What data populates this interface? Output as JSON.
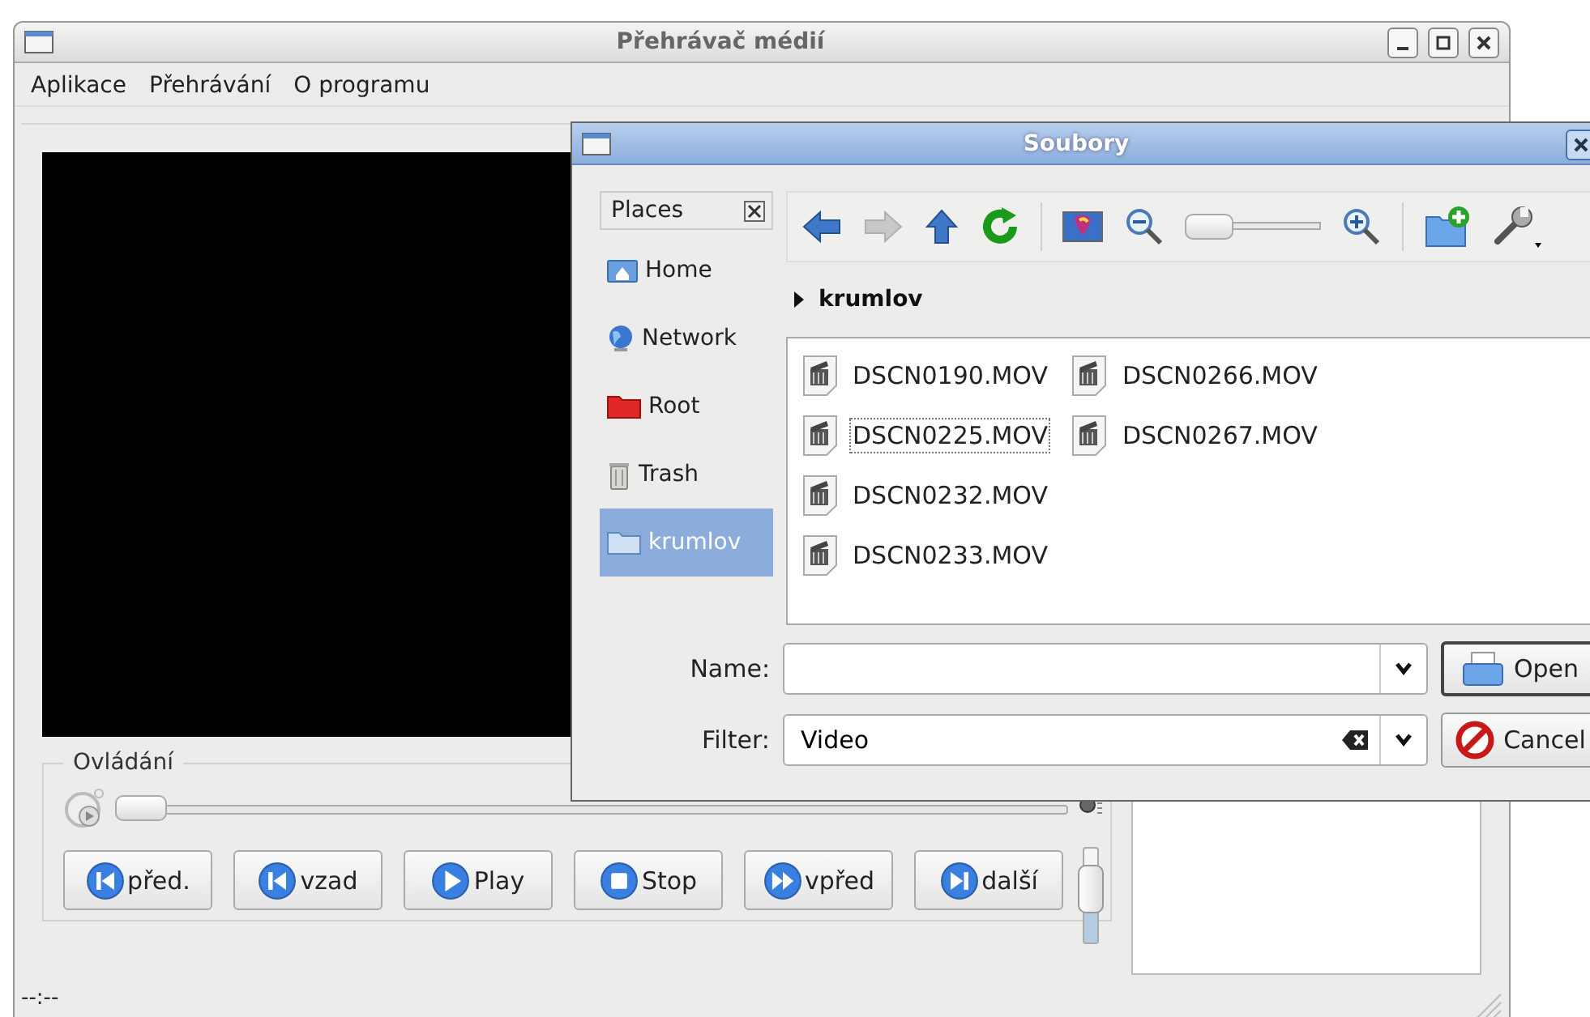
{
  "main_window": {
    "title": "Přehrávač médií",
    "menu": [
      {
        "label": "Aplikace"
      },
      {
        "label": "Přehrávání"
      },
      {
        "label": "O programu"
      }
    ],
    "controls": {
      "title": "Ovládání",
      "seek": {
        "level": 0
      },
      "volume": {
        "level": 0.8
      },
      "buttons": [
        {
          "kind": "prev",
          "label": "před."
        },
        {
          "kind": "back",
          "label": "vzad"
        },
        {
          "kind": "play",
          "label": "Play"
        },
        {
          "kind": "stop",
          "label": "Stop"
        },
        {
          "kind": "forward",
          "label": "vpřed"
        },
        {
          "kind": "next",
          "label": "další"
        }
      ]
    },
    "status_bar": "--:--"
  },
  "dialog": {
    "title": "Soubory",
    "places": {
      "title": "Places",
      "items": [
        {
          "kind": "home",
          "label": "Home",
          "selected": false
        },
        {
          "kind": "network",
          "label": "Network",
          "selected": false
        },
        {
          "kind": "root",
          "label": "Root",
          "selected": false
        },
        {
          "kind": "trash",
          "label": "Trash",
          "selected": false
        },
        {
          "kind": "folder",
          "label": "krumlov",
          "selected": true
        }
      ]
    },
    "toolbar": [
      {
        "kind": "back",
        "disabled": false
      },
      {
        "kind": "forward",
        "disabled": true
      },
      {
        "kind": "up",
        "disabled": false
      },
      {
        "kind": "reload",
        "disabled": false
      },
      {
        "kind": "separator"
      },
      {
        "kind": "image",
        "disabled": false
      },
      {
        "kind": "zoom_out",
        "disabled": false
      },
      {
        "kind": "zoom_slider"
      },
      {
        "kind": "zoom_in",
        "disabled": false
      },
      {
        "kind": "separator"
      },
      {
        "kind": "new_folder",
        "disabled": false
      },
      {
        "kind": "tools",
        "disabled": false
      }
    ],
    "path": "krumlov",
    "files": [
      {
        "name": "DSCN0190.MOV",
        "focused": false
      },
      {
        "name": "DSCN0225.MOV",
        "focused": true
      },
      {
        "name": "DSCN0232.MOV",
        "focused": false
      },
      {
        "name": "DSCN0233.MOV",
        "focused": false
      },
      {
        "name": "DSCN0266.MOV",
        "focused": false
      },
      {
        "name": "DSCN0267.MOV",
        "focused": false
      }
    ],
    "name_field": {
      "label": "Name:"
    },
    "filter_field": {
      "label": "Filter:",
      "value": "Video"
    },
    "buttons": [
      {
        "kind": "open",
        "label": "Open"
      },
      {
        "kind": "cancel",
        "label": "Cancel"
      }
    ]
  }
}
